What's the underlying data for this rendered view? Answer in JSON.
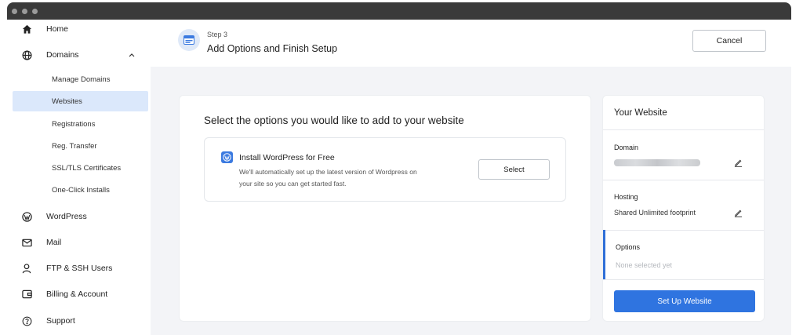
{
  "sidebar": {
    "home": {
      "label": "Home",
      "icon": "home-icon"
    },
    "domains": {
      "label": "Domains",
      "icon": "globe-icon",
      "chevron": "^"
    },
    "sub_items": [
      {
        "label": "Manage Domains"
      },
      {
        "label": "Websites",
        "active": true
      },
      {
        "label": "Registrations"
      },
      {
        "label": "Reg. Transfer"
      },
      {
        "label": "SSL/TLS Certificates"
      },
      {
        "label": "One-Click Installs"
      }
    ],
    "bottom_items": [
      {
        "label": "WordPress",
        "icon": "wordpress-icon"
      },
      {
        "label": "Mail",
        "icon": "mail-icon"
      },
      {
        "label": "FTP & SSH Users",
        "icon": "user-icon"
      },
      {
        "label": "Billing & Account",
        "icon": "wallet-icon"
      },
      {
        "label": "Support",
        "icon": "help-icon"
      }
    ]
  },
  "header": {
    "step_label": "Step 3",
    "title": "Add Options and Finish Setup",
    "cancel_label": "Cancel",
    "step_icon": "browser-window-icon"
  },
  "main": {
    "heading": "Select the options you would like to add to your website",
    "option": {
      "title": "Install WordPress for Free",
      "description": "We'll automatically set up the latest version of Wordpress on your site so you can get started fast.",
      "select_label": "Select",
      "icon": "wordpress-icon"
    }
  },
  "summary": {
    "title": "Your Website",
    "domain_label": "Domain",
    "hosting_label": "Hosting",
    "hosting_value": "Shared Unlimited footprint",
    "options_label": "Options",
    "options_placeholder": "None selected yet",
    "setup_label": "Set Up Website"
  },
  "colors": {
    "accent": "#2f74e0",
    "active_nav_bg": "#dbe8fb",
    "canvas_bg": "#f3f4f7",
    "titlebar": "#3a3a3a"
  }
}
